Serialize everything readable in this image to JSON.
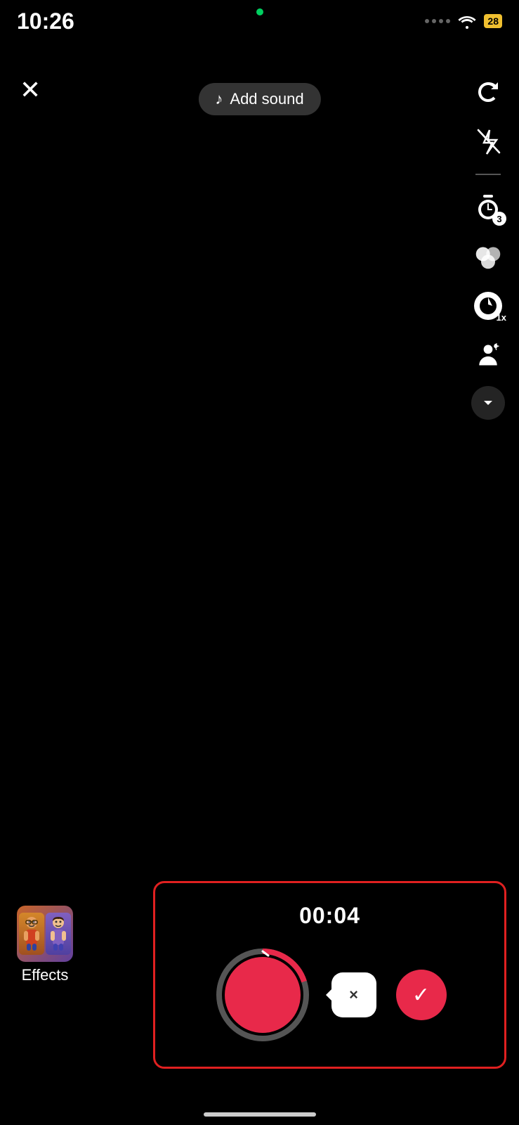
{
  "statusBar": {
    "time": "10:26",
    "batteryLevel": "28",
    "batteryIcon": "⚡"
  },
  "topControls": {
    "closeLabel": "×",
    "addSoundLabel": "Add sound",
    "musicNoteIcon": "♪"
  },
  "toolbar": {
    "flipIcon": "flip-icon",
    "flashIcon": "flash-off-icon",
    "timerIcon": "timer-icon",
    "timerBadge": "3",
    "filtersIcon": "filters-icon",
    "speedIcon": "speed-icon",
    "speedBadge": "1x",
    "effectsPersonIcon": "effects-person-icon",
    "chevronIcon": "chevron-down-icon"
  },
  "recording": {
    "timer": "00:04",
    "deleteLabel": "×",
    "confirmLabel": "✓",
    "progressPercent": 20
  },
  "effects": {
    "label": "Effects",
    "char1": "👨",
    "char2": "👩"
  },
  "homeIndicator": {}
}
